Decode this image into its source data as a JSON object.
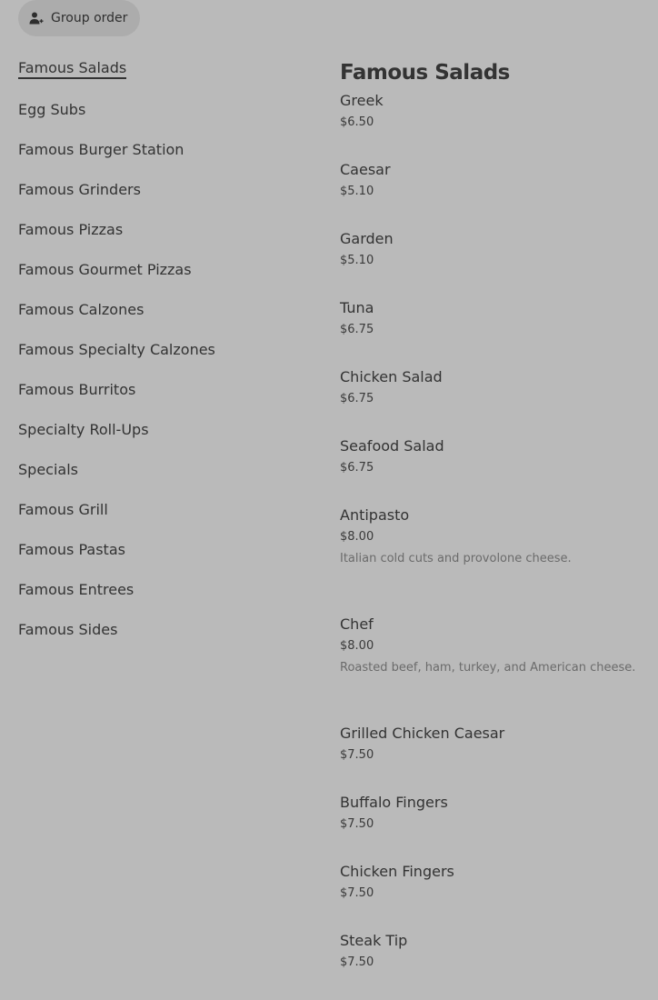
{
  "header": {
    "group_order_label": "Group order",
    "group_order_icon": "person-plus-icon"
  },
  "sidebar": {
    "active_index": 0,
    "items": [
      {
        "label": "Famous Salads"
      },
      {
        "label": "Egg Subs"
      },
      {
        "label": "Famous Burger Station"
      },
      {
        "label": "Famous Grinders"
      },
      {
        "label": "Famous Pizzas"
      },
      {
        "label": "Famous Gourmet Pizzas"
      },
      {
        "label": "Famous Calzones"
      },
      {
        "label": "Famous Specialty Calzones"
      },
      {
        "label": "Famous Burritos"
      },
      {
        "label": "Specialty Roll-Ups"
      },
      {
        "label": "Specials"
      },
      {
        "label": "Famous Grill"
      },
      {
        "label": "Famous Pastas"
      },
      {
        "label": "Famous Entrees"
      },
      {
        "label": "Famous Sides"
      }
    ]
  },
  "main": {
    "section_title": "Famous Salads",
    "items": [
      {
        "name": "Greek",
        "price": "$6.50",
        "desc": ""
      },
      {
        "name": "Caesar",
        "price": "$5.10",
        "desc": ""
      },
      {
        "name": "Garden",
        "price": "$5.10",
        "desc": ""
      },
      {
        "name": "Tuna",
        "price": "$6.75",
        "desc": ""
      },
      {
        "name": "Chicken Salad",
        "price": "$6.75",
        "desc": ""
      },
      {
        "name": "Seafood Salad",
        "price": "$6.75",
        "desc": ""
      },
      {
        "name": "Antipasto",
        "price": "$8.00",
        "desc": "Italian cold cuts and provolone cheese."
      },
      {
        "name": "Chef",
        "price": "$8.00",
        "desc": "Roasted beef, ham, turkey, and American cheese."
      },
      {
        "name": "Grilled Chicken Caesar",
        "price": "$7.50",
        "desc": ""
      },
      {
        "name": "Buffalo Fingers",
        "price": "$7.50",
        "desc": ""
      },
      {
        "name": "Chicken Fingers",
        "price": "$7.50",
        "desc": ""
      },
      {
        "name": "Steak Tip",
        "price": "$7.50",
        "desc": ""
      }
    ]
  },
  "colors": {
    "background": "#bababa",
    "text": "#333333",
    "muted": "#6b6b6b",
    "button_bg": "#acacac"
  }
}
